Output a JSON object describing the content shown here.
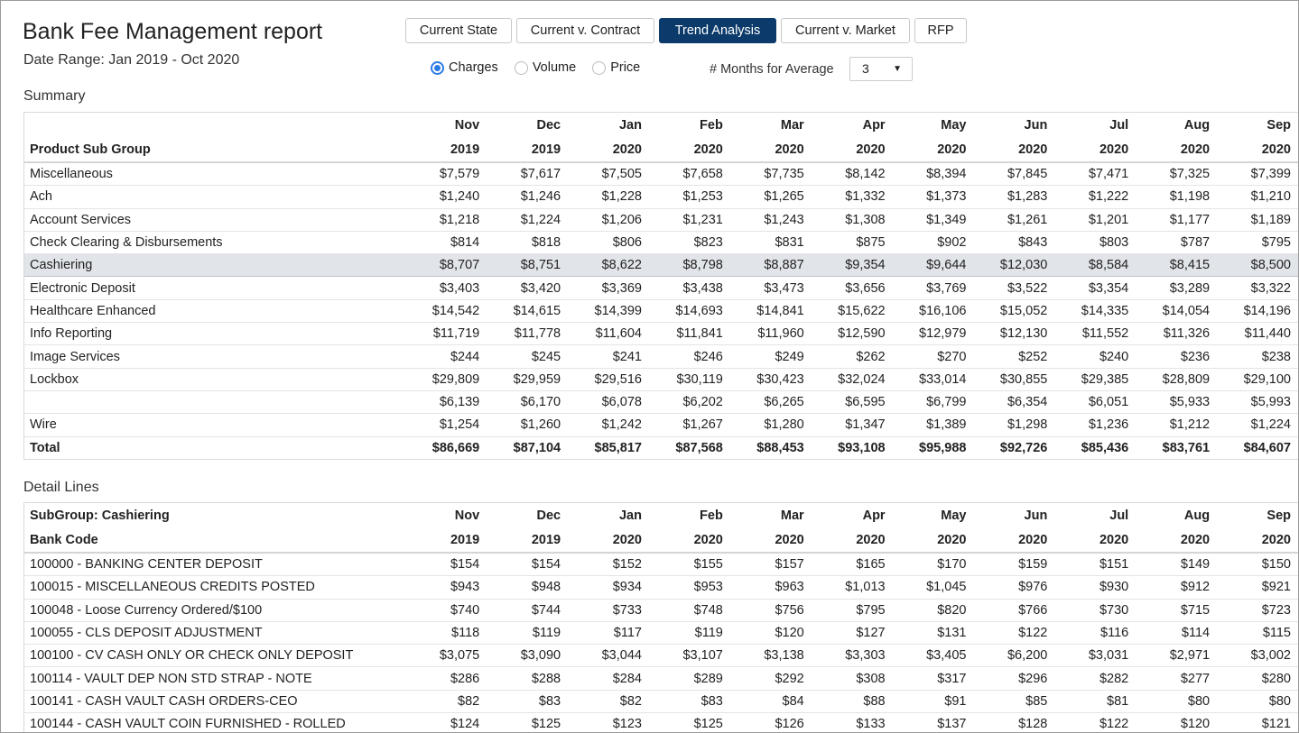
{
  "report": {
    "title": "Bank Fee Management report",
    "date_range": "Date Range: Jan 2019 - Oct 2020"
  },
  "tabs": [
    {
      "label": "Current State",
      "active": false
    },
    {
      "label": "Current v. Contract",
      "active": false
    },
    {
      "label": "Trend Analysis",
      "active": true
    },
    {
      "label": "Current v. Market",
      "active": false
    },
    {
      "label": "RFP",
      "active": false
    }
  ],
  "metric_options": [
    {
      "label": "Charges",
      "selected": true
    },
    {
      "label": "Volume",
      "selected": false
    },
    {
      "label": "Price",
      "selected": false
    }
  ],
  "months_avg": {
    "label": "# Months for Average",
    "value": "3"
  },
  "colors": {
    "accent": "#0b3a6b",
    "radio": "#2c7be5",
    "highlight_row": "#e1e4e8"
  },
  "summary": {
    "section_label": "Summary",
    "first_col_header": "Product Sub Group",
    "months": [
      {
        "m": "Nov",
        "y": "2019"
      },
      {
        "m": "Dec",
        "y": "2019"
      },
      {
        "m": "Jan",
        "y": "2020"
      },
      {
        "m": "Feb",
        "y": "2020"
      },
      {
        "m": "Mar",
        "y": "2020"
      },
      {
        "m": "Apr",
        "y": "2020"
      },
      {
        "m": "May",
        "y": "2020"
      },
      {
        "m": "Jun",
        "y": "2020"
      },
      {
        "m": "Jul",
        "y": "2020"
      },
      {
        "m": "Aug",
        "y": "2020"
      },
      {
        "m": "Sep",
        "y": "2020"
      }
    ],
    "rows": [
      {
        "name": "Miscellaneous",
        "values": [
          "$7,579",
          "$7,617",
          "$7,505",
          "$7,658",
          "$7,735",
          "$8,142",
          "$8,394",
          "$7,845",
          "$7,471",
          "$7,325",
          "$7,399"
        ]
      },
      {
        "name": "Ach",
        "values": [
          "$1,240",
          "$1,246",
          "$1,228",
          "$1,253",
          "$1,265",
          "$1,332",
          "$1,373",
          "$1,283",
          "$1,222",
          "$1,198",
          "$1,210"
        ]
      },
      {
        "name": "Account Services",
        "values": [
          "$1,218",
          "$1,224",
          "$1,206",
          "$1,231",
          "$1,243",
          "$1,308",
          "$1,349",
          "$1,261",
          "$1,201",
          "$1,177",
          "$1,189"
        ]
      },
      {
        "name": "Check Clearing & Disbursements",
        "values": [
          "$814",
          "$818",
          "$806",
          "$823",
          "$831",
          "$875",
          "$902",
          "$843",
          "$803",
          "$787",
          "$795"
        ]
      },
      {
        "name": "Cashiering",
        "highlight": true,
        "values": [
          "$8,707",
          "$8,751",
          "$8,622",
          "$8,798",
          "$8,887",
          "$9,354",
          "$9,644",
          "$12,030",
          "$8,584",
          "$8,415",
          "$8,500"
        ]
      },
      {
        "name": "Electronic Deposit",
        "values": [
          "$3,403",
          "$3,420",
          "$3,369",
          "$3,438",
          "$3,473",
          "$3,656",
          "$3,769",
          "$3,522",
          "$3,354",
          "$3,289",
          "$3,322"
        ]
      },
      {
        "name": "Healthcare Enhanced",
        "values": [
          "$14,542",
          "$14,615",
          "$14,399",
          "$14,693",
          "$14,841",
          "$15,622",
          "$16,106",
          "$15,052",
          "$14,335",
          "$14,054",
          "$14,196"
        ]
      },
      {
        "name": "Info Reporting",
        "values": [
          "$11,719",
          "$11,778",
          "$11,604",
          "$11,841",
          "$11,960",
          "$12,590",
          "$12,979",
          "$12,130",
          "$11,552",
          "$11,326",
          "$11,440"
        ]
      },
      {
        "name": "Image Services",
        "values": [
          "$244",
          "$245",
          "$241",
          "$246",
          "$249",
          "$262",
          "$270",
          "$252",
          "$240",
          "$236",
          "$238"
        ]
      },
      {
        "name": "Lockbox",
        "values": [
          "$29,809",
          "$29,959",
          "$29,516",
          "$30,119",
          "$30,423",
          "$32,024",
          "$33,014",
          "$30,855",
          "$29,385",
          "$28,809",
          "$29,100"
        ]
      },
      {
        "name": "",
        "values": [
          "$6,139",
          "$6,170",
          "$6,078",
          "$6,202",
          "$6,265",
          "$6,595",
          "$6,799",
          "$6,354",
          "$6,051",
          "$5,933",
          "$5,993"
        ]
      },
      {
        "name": "Wire",
        "values": [
          "$1,254",
          "$1,260",
          "$1,242",
          "$1,267",
          "$1,280",
          "$1,347",
          "$1,389",
          "$1,298",
          "$1,236",
          "$1,212",
          "$1,224"
        ]
      }
    ],
    "total": {
      "name": "Total",
      "values": [
        "$86,669",
        "$87,104",
        "$85,817",
        "$87,568",
        "$88,453",
        "$93,108",
        "$95,988",
        "$92,726",
        "$85,436",
        "$83,761",
        "$84,607"
      ]
    }
  },
  "detail": {
    "section_label": "Detail Lines",
    "subgroup_header": "SubGroup: Cashiering",
    "first_col_header": "Bank Code",
    "months": [
      {
        "m": "Nov",
        "y": "2019"
      },
      {
        "m": "Dec",
        "y": "2019"
      },
      {
        "m": "Jan",
        "y": "2020"
      },
      {
        "m": "Feb",
        "y": "2020"
      },
      {
        "m": "Mar",
        "y": "2020"
      },
      {
        "m": "Apr",
        "y": "2020"
      },
      {
        "m": "May",
        "y": "2020"
      },
      {
        "m": "Jun",
        "y": "2020"
      },
      {
        "m": "Jul",
        "y": "2020"
      },
      {
        "m": "Aug",
        "y": "2020"
      },
      {
        "m": "Sep",
        "y": "2020"
      }
    ],
    "rows": [
      {
        "name": "100000 - BANKING CENTER DEPOSIT",
        "values": [
          "$154",
          "$154",
          "$152",
          "$155",
          "$157",
          "$165",
          "$170",
          "$159",
          "$151",
          "$149",
          "$150"
        ]
      },
      {
        "name": "100015 - MISCELLANEOUS CREDITS POSTED",
        "values": [
          "$943",
          "$948",
          "$934",
          "$953",
          "$963",
          "$1,013",
          "$1,045",
          "$976",
          "$930",
          "$912",
          "$921"
        ]
      },
      {
        "name": "100048 - Loose Currency Ordered/$100",
        "values": [
          "$740",
          "$744",
          "$733",
          "$748",
          "$756",
          "$795",
          "$820",
          "$766",
          "$730",
          "$715",
          "$723"
        ]
      },
      {
        "name": "100055 - CLS DEPOSIT ADJUSTMENT",
        "values": [
          "$118",
          "$119",
          "$117",
          "$119",
          "$120",
          "$127",
          "$131",
          "$122",
          "$116",
          "$114",
          "$115"
        ]
      },
      {
        "name": "100100 - CV CASH ONLY OR CHECK ONLY DEPOSIT",
        "values": [
          "$3,075",
          "$3,090",
          "$3,044",
          "$3,107",
          "$3,138",
          "$3,303",
          "$3,405",
          "$6,200",
          "$3,031",
          "$2,971",
          "$3,002"
        ]
      },
      {
        "name": "100114 - VAULT DEP NON STD STRAP - NOTE",
        "values": [
          "$286",
          "$288",
          "$284",
          "$289",
          "$292",
          "$308",
          "$317",
          "$296",
          "$282",
          "$277",
          "$280"
        ]
      },
      {
        "name": "100141 - CASH VAULT CASH ORDERS-CEO",
        "values": [
          "$82",
          "$83",
          "$82",
          "$83",
          "$84",
          "$88",
          "$91",
          "$85",
          "$81",
          "$80",
          "$80"
        ]
      },
      {
        "name": "100144 - CASH VAULT COIN FURNISHED - ROLLED",
        "values": [
          "$124",
          "$125",
          "$123",
          "$125",
          "$126",
          "$133",
          "$137",
          "$128",
          "$122",
          "$120",
          "$121"
        ]
      }
    ]
  }
}
